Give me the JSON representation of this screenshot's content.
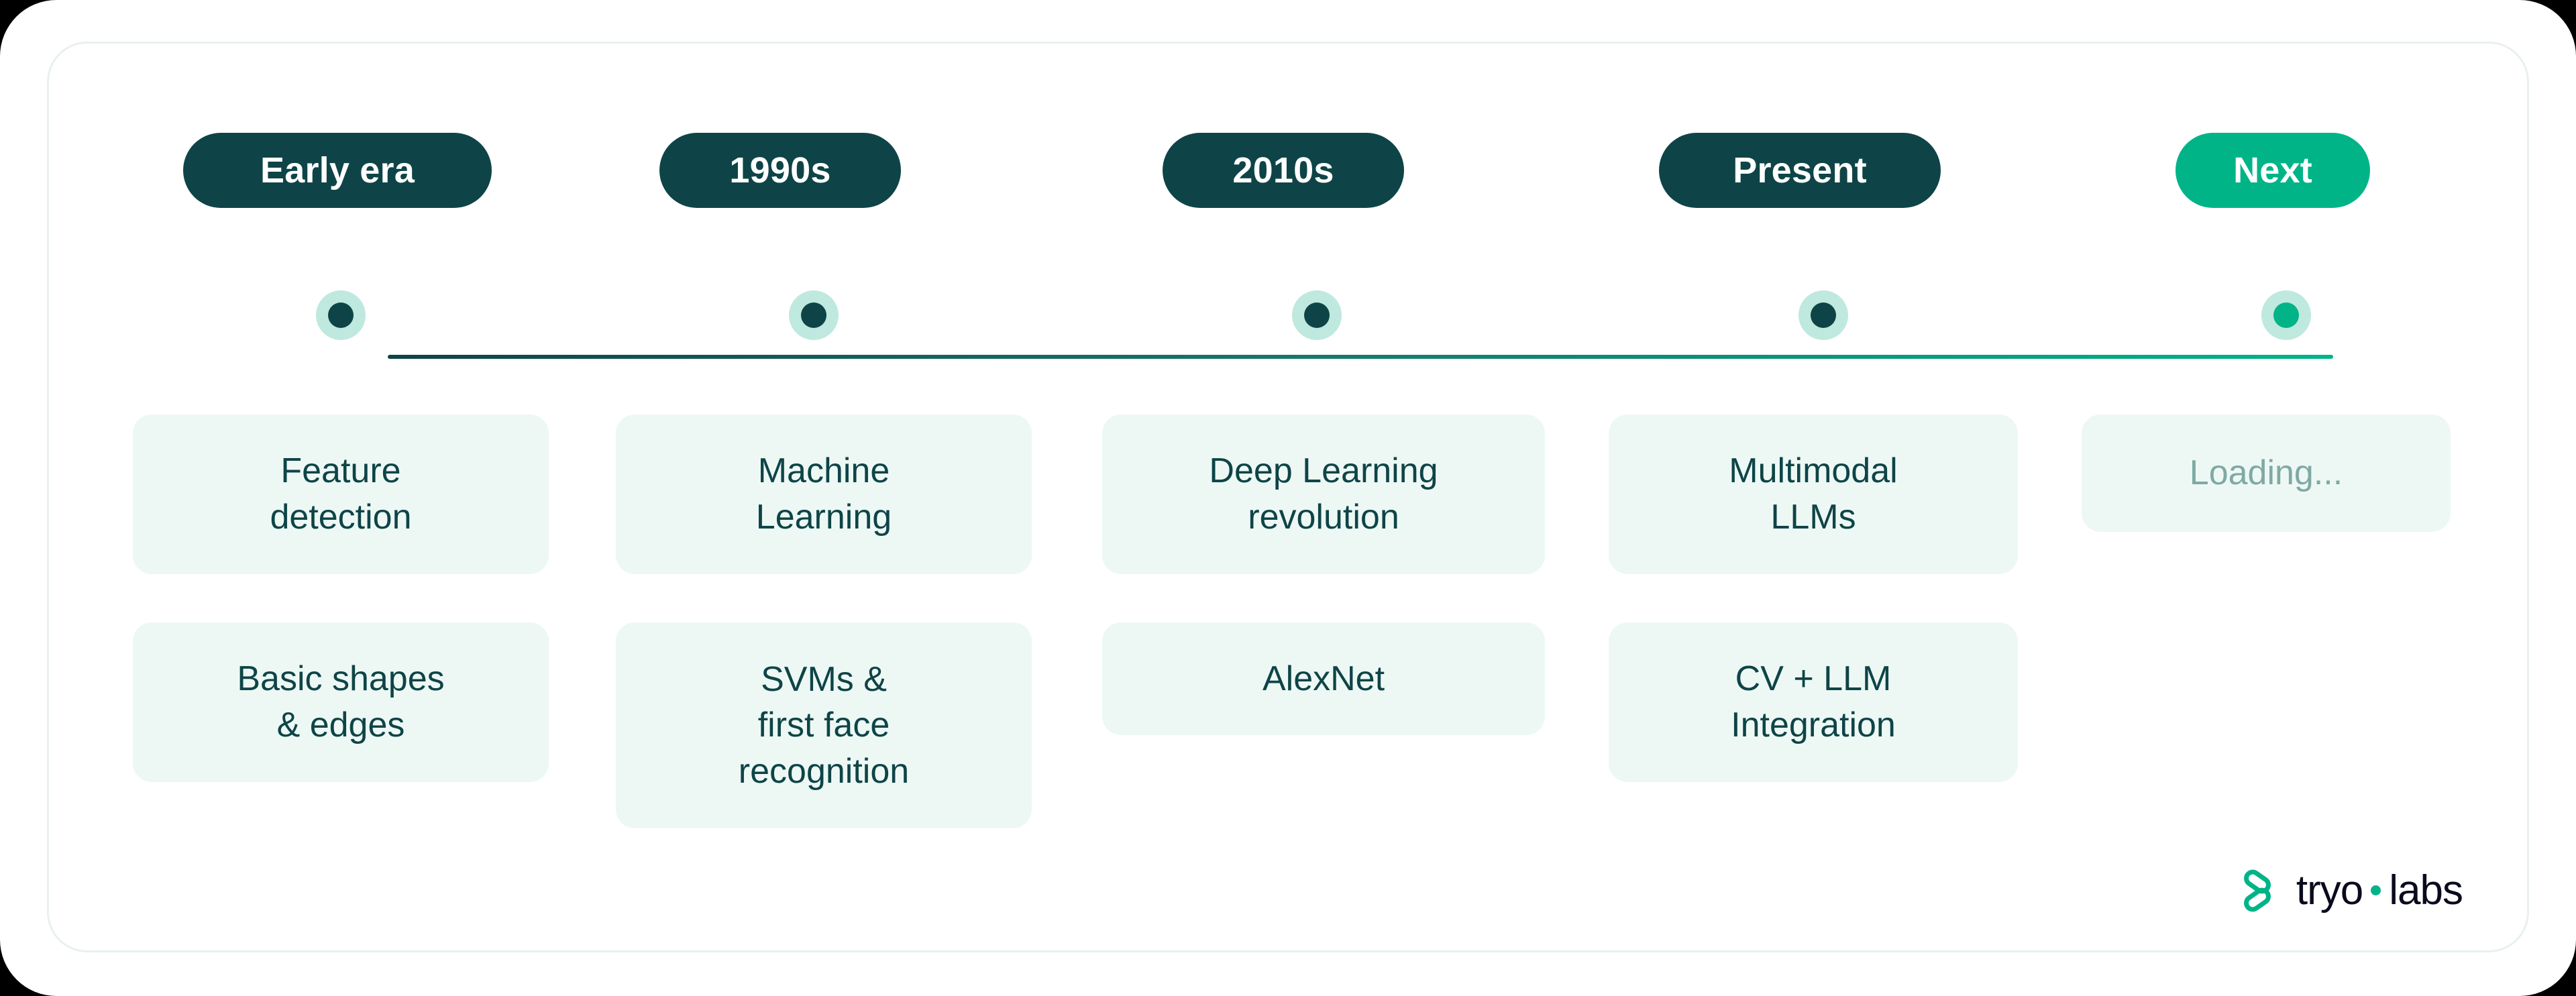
{
  "theme": {
    "surface": "#FFFFFF",
    "panel_border": "#E9F0EF",
    "pill_dark": "#0E4447",
    "accent": "#00B488",
    "card_bg": "#EDF8F4",
    "card_text": "#0E4447",
    "muted_text": "#7FA9A4",
    "node_glow": "#BFE9DE"
  },
  "timeline": {
    "stages": [
      {
        "pill_label": "Early era",
        "pill_style": "dark",
        "node_style": "dark",
        "cards": [
          {
            "lines": [
              "Feature",
              "detection"
            ],
            "state": "filled"
          },
          {
            "lines": [
              "Basic shapes",
              "& edges"
            ],
            "state": "filled"
          }
        ]
      },
      {
        "pill_label": "1990s",
        "pill_style": "dark",
        "node_style": "dark",
        "cards": [
          {
            "lines": [
              "Machine",
              "Learning"
            ],
            "state": "filled"
          },
          {
            "lines": [
              "SVMs &",
              "first face",
              "recognition"
            ],
            "state": "filled"
          }
        ]
      },
      {
        "pill_label": "2010s",
        "pill_style": "dark",
        "node_style": "dark",
        "cards": [
          {
            "lines": [
              "Deep Learning",
              "revolution"
            ],
            "state": "filled"
          },
          {
            "lines": [
              "AlexNet"
            ],
            "state": "filled"
          }
        ]
      },
      {
        "pill_label": "Present",
        "pill_style": "dark",
        "node_style": "dark",
        "cards": [
          {
            "lines": [
              "Multimodal",
              "LLMs"
            ],
            "state": "filled"
          },
          {
            "lines": [
              "CV + LLM",
              "Integration"
            ],
            "state": "filled"
          }
        ]
      },
      {
        "pill_label": "Next",
        "pill_style": "accent",
        "node_style": "accent",
        "cards": [
          {
            "lines": [
              "Loading..."
            ],
            "state": "loading"
          }
        ]
      }
    ]
  },
  "brand": {
    "name_primary": "tryo",
    "name_secondary": "labs",
    "mark": "tryolabs-mark-icon"
  }
}
